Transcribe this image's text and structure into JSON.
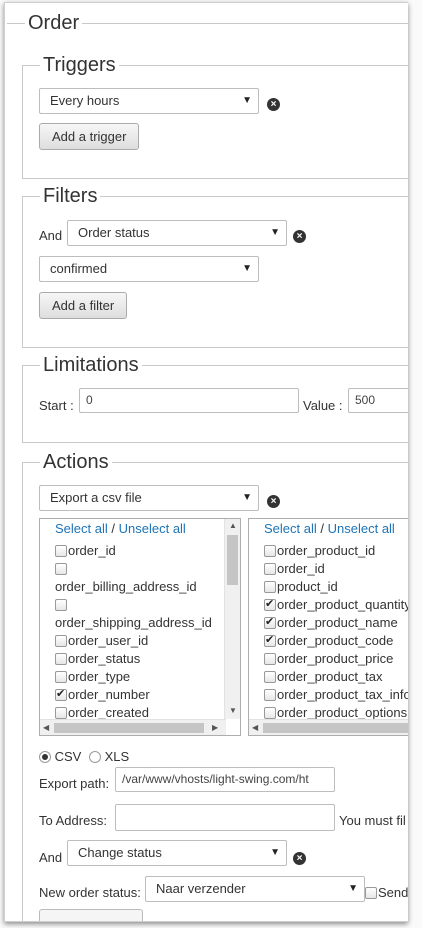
{
  "order": {
    "title": "Order"
  },
  "triggers": {
    "title": "Triggers",
    "select_value": "Every hours",
    "add_label": "Add a trigger"
  },
  "filters": {
    "title": "Filters",
    "and_label": "And",
    "filter_select": "Order status",
    "status_select": "confirmed",
    "add_label": "Add a filter"
  },
  "limitations": {
    "title": "Limitations",
    "start_label": "Start :",
    "start_value": "0",
    "value_label": "Value :",
    "value_value": "500"
  },
  "actions": {
    "title": "Actions",
    "action_select": "Export a csv file",
    "select_all": "Select all",
    "separator": "/",
    "unselect_all": "Unselect all",
    "left_fields": [
      {
        "label": "order_id",
        "checked": false
      },
      {
        "label": "",
        "checked": false
      },
      {
        "label": "order_billing_address_id",
        "checked": null
      },
      {
        "label": "",
        "checked": false
      },
      {
        "label": "order_shipping_address_id",
        "checked": null
      },
      {
        "label": "order_user_id",
        "checked": false
      },
      {
        "label": "order_status",
        "checked": false
      },
      {
        "label": "order_type",
        "checked": false
      },
      {
        "label": "order_number",
        "checked": true
      },
      {
        "label": "order_created",
        "checked": false
      }
    ],
    "right_fields": [
      {
        "label": "order_product_id",
        "checked": false
      },
      {
        "label": "order_id",
        "checked": false
      },
      {
        "label": "product_id",
        "checked": false
      },
      {
        "label": "order_product_quantity",
        "checked": true
      },
      {
        "label": "order_product_name",
        "checked": true
      },
      {
        "label": "order_product_code",
        "checked": true
      },
      {
        "label": "order_product_price",
        "checked": false
      },
      {
        "label": "order_product_tax",
        "checked": false
      },
      {
        "label": "order_product_tax_info",
        "checked": false
      },
      {
        "label": "order_product_options",
        "checked": false
      }
    ],
    "format_csv": "CSV",
    "format_xls": "XLS",
    "format_selected": "CSV",
    "export_path_label": "Export path:",
    "export_path_value": "/var/www/vhosts/light-swing.com/ht",
    "to_address_label": "To Address:",
    "to_address_value": "",
    "must_fill_text": "You must fil",
    "and_label": "And",
    "change_select": "Change status",
    "new_status_label": "New order status:",
    "new_status_select": "Naar verzender",
    "send_label": "Send"
  }
}
